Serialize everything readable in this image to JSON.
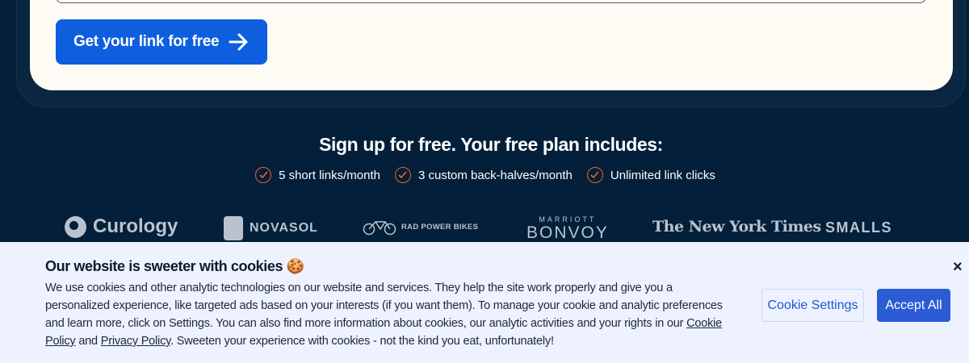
{
  "hero": {
    "cta_label": "Get your link for free"
  },
  "plan": {
    "title": "Sign up for free. Your free plan includes:",
    "features": [
      "5 short links/month",
      "3 custom back-halves/month",
      "Unlimited link clicks"
    ]
  },
  "logos": {
    "curology": "Curology",
    "novasol": "NOVASOL",
    "rad": "RAD POWER BIKES",
    "marriott_top": "MARRIOTT",
    "marriott_bottom": "BONVOY",
    "nyt": "The New York Times",
    "smalls": "SMALLS"
  },
  "cookie": {
    "title": "Our website is sweeter with cookies 🍪",
    "body_1": "We use cookies and other analytic technologies on our website and services. They help the site work properly and give you a personalized experience, like targeted ads based on your interests (if you want them). To manage your cookie and analytic preferences and learn more, click on Settings. You can also find more information about cookies, our analytic activities and your rights in our ",
    "cookie_policy_link": "Cookie Policy",
    "and": " and ",
    "privacy_policy_link": "Privacy Policy",
    "body_2": ". Sweeten your experience with cookies - not the kind you eat, unfortunately!",
    "close_label": "×",
    "settings_label": "Cookie Settings",
    "accept_label": "Accept All"
  },
  "colors": {
    "background": "#031f39",
    "card": "#fdfbf4",
    "cta": "#0d5fe0",
    "check": "#ee6123",
    "cookie_bg": "#eef2fe",
    "accept": "#2b5cd6"
  }
}
